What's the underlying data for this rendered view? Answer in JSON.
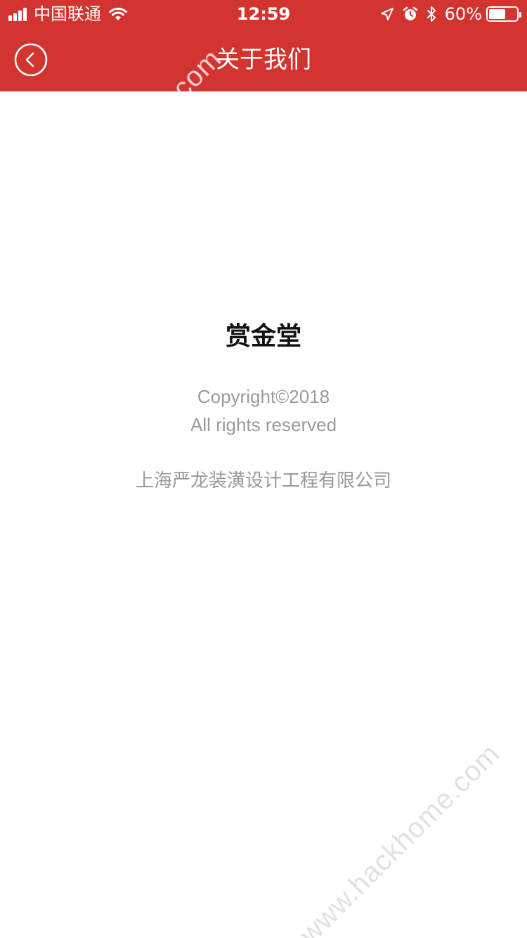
{
  "status_bar": {
    "carrier": "中国联通",
    "time": "12:59",
    "battery_percent": "60%",
    "battery_level": 0.6,
    "icons": [
      "signal-icon",
      "wifi-icon",
      "location-arrow-icon",
      "alarm-icon",
      "bluetooth-icon",
      "battery-icon"
    ]
  },
  "nav": {
    "title": "关于我们",
    "back_icon": "chevron-left-circle-icon"
  },
  "about": {
    "app_name": "赏金堂",
    "copyright": "Copyright©2018",
    "rights": "All rights reserved",
    "company": "上海严龙装潢设计工程有限公司"
  },
  "watermark": {
    "text": "www.hackhome.com"
  },
  "colors": {
    "header_bg": "#d23430",
    "header_text": "#ffffff",
    "title_text": "#111111",
    "secondary_text": "#9a9a9a",
    "background": "#ffffff"
  }
}
